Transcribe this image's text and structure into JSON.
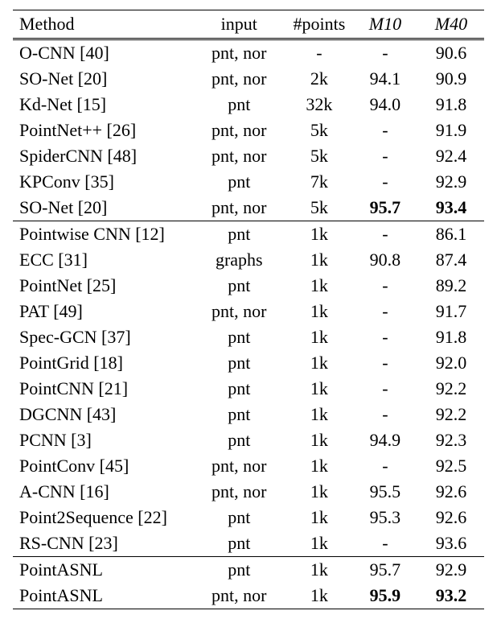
{
  "headers": {
    "method": "Method",
    "input": "input",
    "points": "#points",
    "m10": "M10",
    "m40": "M40"
  },
  "sections": [
    {
      "rows": [
        {
          "method": "O-CNN [40]",
          "input": "pnt, nor",
          "points": "-",
          "m10": "-",
          "m40": "90.6"
        },
        {
          "method": "SO-Net [20]",
          "input": "pnt, nor",
          "points": "2k",
          "m10": "94.1",
          "m40": "90.9"
        },
        {
          "method": "Kd-Net [15]",
          "input": "pnt",
          "points": "32k",
          "m10": "94.0",
          "m40": "91.8"
        },
        {
          "method": "PointNet++ [26]",
          "input": "pnt, nor",
          "points": "5k",
          "m10": "-",
          "m40": "91.9"
        },
        {
          "method": "SpiderCNN [48]",
          "input": "pnt, nor",
          "points": "5k",
          "m10": "-",
          "m40": "92.4"
        },
        {
          "method": "KPConv [35]",
          "input": "pnt",
          "points": "7k",
          "m10": "-",
          "m40": "92.9"
        },
        {
          "method": "SO-Net [20]",
          "input": "pnt, nor",
          "points": "5k",
          "m10": "95.7",
          "m40": "93.4",
          "m10_bold": true,
          "m40_bold": true
        }
      ]
    },
    {
      "rows": [
        {
          "method": "Pointwise CNN [12]",
          "input": "pnt",
          "points": "1k",
          "m10": "-",
          "m40": "86.1"
        },
        {
          "method": "ECC [31]",
          "input": "graphs",
          "points": "1k",
          "m10": "90.8",
          "m40": "87.4"
        },
        {
          "method": "PointNet [25]",
          "input": "pnt",
          "points": "1k",
          "m10": "-",
          "m40": "89.2"
        },
        {
          "method": "PAT [49]",
          "input": "pnt, nor",
          "points": "1k",
          "m10": "-",
          "m40": "91.7"
        },
        {
          "method": "Spec-GCN [37]",
          "input": "pnt",
          "points": "1k",
          "m10": "-",
          "m40": "91.8"
        },
        {
          "method": "PointGrid [18]",
          "input": "pnt",
          "points": "1k",
          "m10": "-",
          "m40": "92.0"
        },
        {
          "method": "PointCNN [21]",
          "input": "pnt",
          "points": "1k",
          "m10": "-",
          "m40": "92.2"
        },
        {
          "method": "DGCNN [43]",
          "input": "pnt",
          "points": "1k",
          "m10": "-",
          "m40": "92.2"
        },
        {
          "method": "PCNN [3]",
          "input": "pnt",
          "points": "1k",
          "m10": "94.9",
          "m40": "92.3"
        },
        {
          "method": "PointConv [45]",
          "input": "pnt, nor",
          "points": "1k",
          "m10": "-",
          "m40": "92.5"
        },
        {
          "method": "A-CNN [16]",
          "input": "pnt, nor",
          "points": "1k",
          "m10": "95.5",
          "m40": "92.6"
        },
        {
          "method": "Point2Sequence [22]",
          "input": "pnt",
          "points": "1k",
          "m10": "95.3",
          "m40": "92.6"
        },
        {
          "method": "RS-CNN [23]",
          "input": "pnt",
          "points": "1k",
          "m10": "-",
          "m40": "93.6"
        }
      ]
    },
    {
      "rows": [
        {
          "method": "PointASNL",
          "input": "pnt",
          "points": "1k",
          "m10": "95.7",
          "m40": "92.9"
        },
        {
          "method": "PointASNL",
          "input": "pnt, nor",
          "points": "1k",
          "m10": "95.9",
          "m40": "93.2",
          "m10_bold": true,
          "m40_bold": true
        }
      ]
    }
  ],
  "chart_data": {
    "type": "table",
    "title": "Method comparison on M10 and M40",
    "columns": [
      "Method",
      "input",
      "#points",
      "M10",
      "M40"
    ],
    "rows": [
      [
        "O-CNN [40]",
        "pnt, nor",
        "-",
        "-",
        90.6
      ],
      [
        "SO-Net [20]",
        "pnt, nor",
        "2k",
        94.1,
        90.9
      ],
      [
        "Kd-Net [15]",
        "pnt",
        "32k",
        94.0,
        91.8
      ],
      [
        "PointNet++ [26]",
        "pnt, nor",
        "5k",
        "-",
        91.9
      ],
      [
        "SpiderCNN [48]",
        "pnt, nor",
        "5k",
        "-",
        92.4
      ],
      [
        "KPConv [35]",
        "pnt",
        "7k",
        "-",
        92.9
      ],
      [
        "SO-Net [20]",
        "pnt, nor",
        "5k",
        95.7,
        93.4
      ],
      [
        "Pointwise CNN [12]",
        "pnt",
        "1k",
        "-",
        86.1
      ],
      [
        "ECC [31]",
        "graphs",
        "1k",
        90.8,
        87.4
      ],
      [
        "PointNet [25]",
        "pnt",
        "1k",
        "-",
        89.2
      ],
      [
        "PAT [49]",
        "pnt, nor",
        "1k",
        "-",
        91.7
      ],
      [
        "Spec-GCN [37]",
        "pnt",
        "1k",
        "-",
        91.8
      ],
      [
        "PointGrid [18]",
        "pnt",
        "1k",
        "-",
        92.0
      ],
      [
        "PointCNN [21]",
        "pnt",
        "1k",
        "-",
        92.2
      ],
      [
        "DGCNN [43]",
        "pnt",
        "1k",
        "-",
        92.2
      ],
      [
        "PCNN [3]",
        "pnt",
        "1k",
        94.9,
        92.3
      ],
      [
        "PointConv [45]",
        "pnt, nor",
        "1k",
        "-",
        92.5
      ],
      [
        "A-CNN [16]",
        "pnt, nor",
        "1k",
        95.5,
        92.6
      ],
      [
        "Point2Sequence [22]",
        "pnt",
        "1k",
        95.3,
        92.6
      ],
      [
        "RS-CNN [23]",
        "pnt",
        "1k",
        "-",
        93.6
      ],
      [
        "PointASNL",
        "pnt",
        "1k",
        95.7,
        92.9
      ],
      [
        "PointASNL",
        "pnt, nor",
        "1k",
        95.9,
        93.2
      ]
    ]
  }
}
